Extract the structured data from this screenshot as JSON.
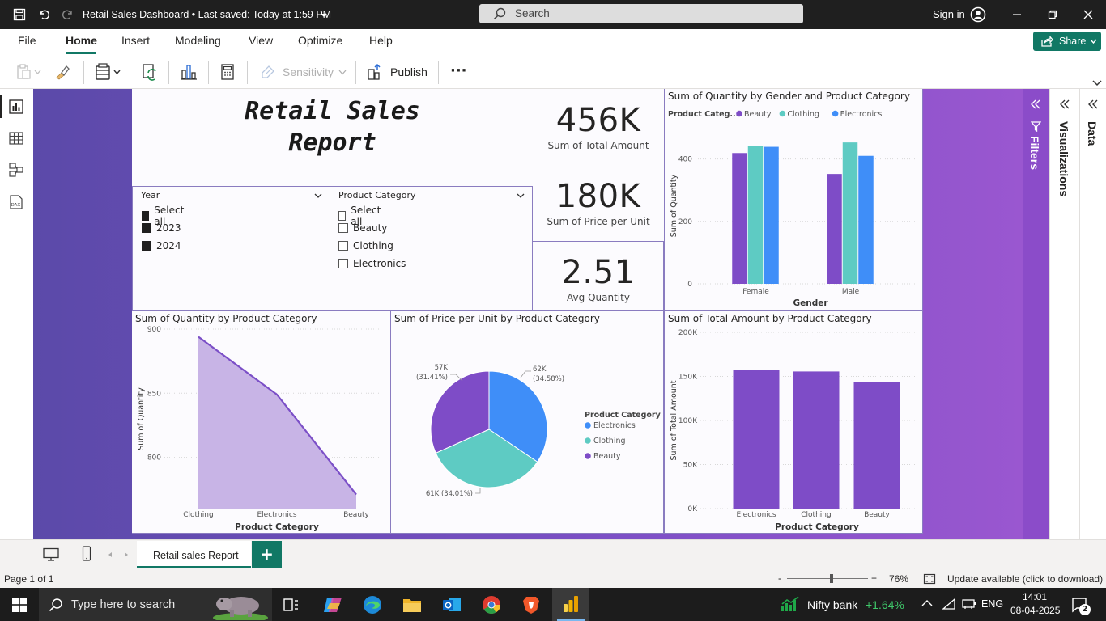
{
  "titlebar": {
    "title": "Retail Sales Dashboard • Last saved: Today at 1:59 PM",
    "search_label": "Search",
    "signin_label": "Sign in"
  },
  "ribbon": {
    "tabs": [
      "File",
      "Home",
      "Insert",
      "Modeling",
      "View",
      "Optimize",
      "Help"
    ],
    "active_tab": "Home",
    "share_label": "Share"
  },
  "toolbar": {
    "sensitivity_label": "Sensitivity",
    "publish_label": "Publish",
    "more_label": "···"
  },
  "report": {
    "title_line1": "Retail Sales",
    "title_line2": "Report",
    "kpis": [
      {
        "value": "456K",
        "caption": "Sum of Total Amount"
      },
      {
        "value": "180K",
        "caption": "Sum of Price per Unit"
      },
      {
        "value": "2.51",
        "caption": "Avg Quantity"
      }
    ],
    "slicer_year": {
      "header": "Year",
      "items": [
        {
          "label": "Select all",
          "checked": true
        },
        {
          "label": "2023",
          "checked": true
        },
        {
          "label": "2024",
          "checked": true
        }
      ]
    },
    "slicer_category": {
      "header": "Product Category",
      "items": [
        {
          "label": "Select all",
          "checked": false
        },
        {
          "label": "Beauty",
          "checked": false
        },
        {
          "label": "Clothing",
          "checked": false
        },
        {
          "label": "Electronics",
          "checked": false
        }
      ]
    }
  },
  "chart_data": [
    {
      "type": "bar",
      "title": "Sum of Quantity by Gender and Product Category",
      "legend_title": "Product Categ...",
      "categories": [
        "Female",
        "Male"
      ],
      "series": [
        {
          "name": "Beauty",
          "values": [
            419,
            352
          ],
          "color": "#7e4cc7"
        },
        {
          "name": "Clothing",
          "values": [
            441,
            453
          ],
          "color": "#5ecbc3"
        },
        {
          "name": "Electronics",
          "values": [
            439,
            410
          ],
          "color": "#3f8ef8"
        }
      ],
      "xlabel": "Gender",
      "ylabel": "Sum of Quantity",
      "yticks": [
        "0",
        "200",
        "400"
      ],
      "ylim": [
        0,
        500
      ],
      "legend_position": "top-left"
    },
    {
      "type": "area",
      "title": "Sum of Quantity by Product Category",
      "categories": [
        "Clothing",
        "Electronics",
        "Beauty"
      ],
      "values": [
        894,
        849,
        771
      ],
      "xlabel": "Product Category",
      "ylabel": "Sum of Quantity",
      "yticks": [
        "800",
        "850",
        "900"
      ],
      "ylim": [
        760,
        900
      ],
      "color": "#7b4fc7"
    },
    {
      "type": "pie",
      "title": "Sum of Price per Unit by Product Category",
      "legend_title": "Product Category",
      "slices": [
        {
          "name": "Electronics",
          "value": 62,
          "label": "62K",
          "percent": "(34.58%)",
          "color": "#3f8ef8"
        },
        {
          "name": "Clothing",
          "value": 61,
          "label": "61K (34.01%)",
          "percent": "",
          "color": "#5ecbc3"
        },
        {
          "name": "Beauty",
          "value": 57,
          "label": "57K",
          "percent": "(31.41%)",
          "color": "#7e4cc7"
        }
      ],
      "legend_position": "right"
    },
    {
      "type": "bar",
      "title": "Sum of Total Amount by Product Category",
      "categories": [
        "Electronics",
        "Clothing",
        "Beauty"
      ],
      "values": [
        156905,
        155580,
        143515
      ],
      "xlabel": "Product Category",
      "ylabel": "Sum of Total Amount",
      "yticks": [
        "0K",
        "50K",
        "100K",
        "150K",
        "200K"
      ],
      "ylim": [
        0,
        200000
      ],
      "color": "#7e4cc7"
    }
  ],
  "panes": {
    "filters_label": "Filters",
    "visualizations_label": "Visualizations",
    "data_label": "Data"
  },
  "pages": {
    "tabs": [
      "Retail sales Report"
    ],
    "add_label": "+"
  },
  "status": {
    "page_label": "Page 1 of 1",
    "zoom_minus": "-",
    "zoom_plus": "+",
    "zoom_level": 76,
    "zoom_label": "76%",
    "update_label": "Update available (click to download)"
  },
  "taskbar": {
    "search_placeholder": "Type here to search",
    "stock_name": "Nifty bank",
    "stock_change": "+1.64%",
    "language": "ENG",
    "time": "14:01",
    "date": "08-04-2025",
    "notifications": "2"
  }
}
